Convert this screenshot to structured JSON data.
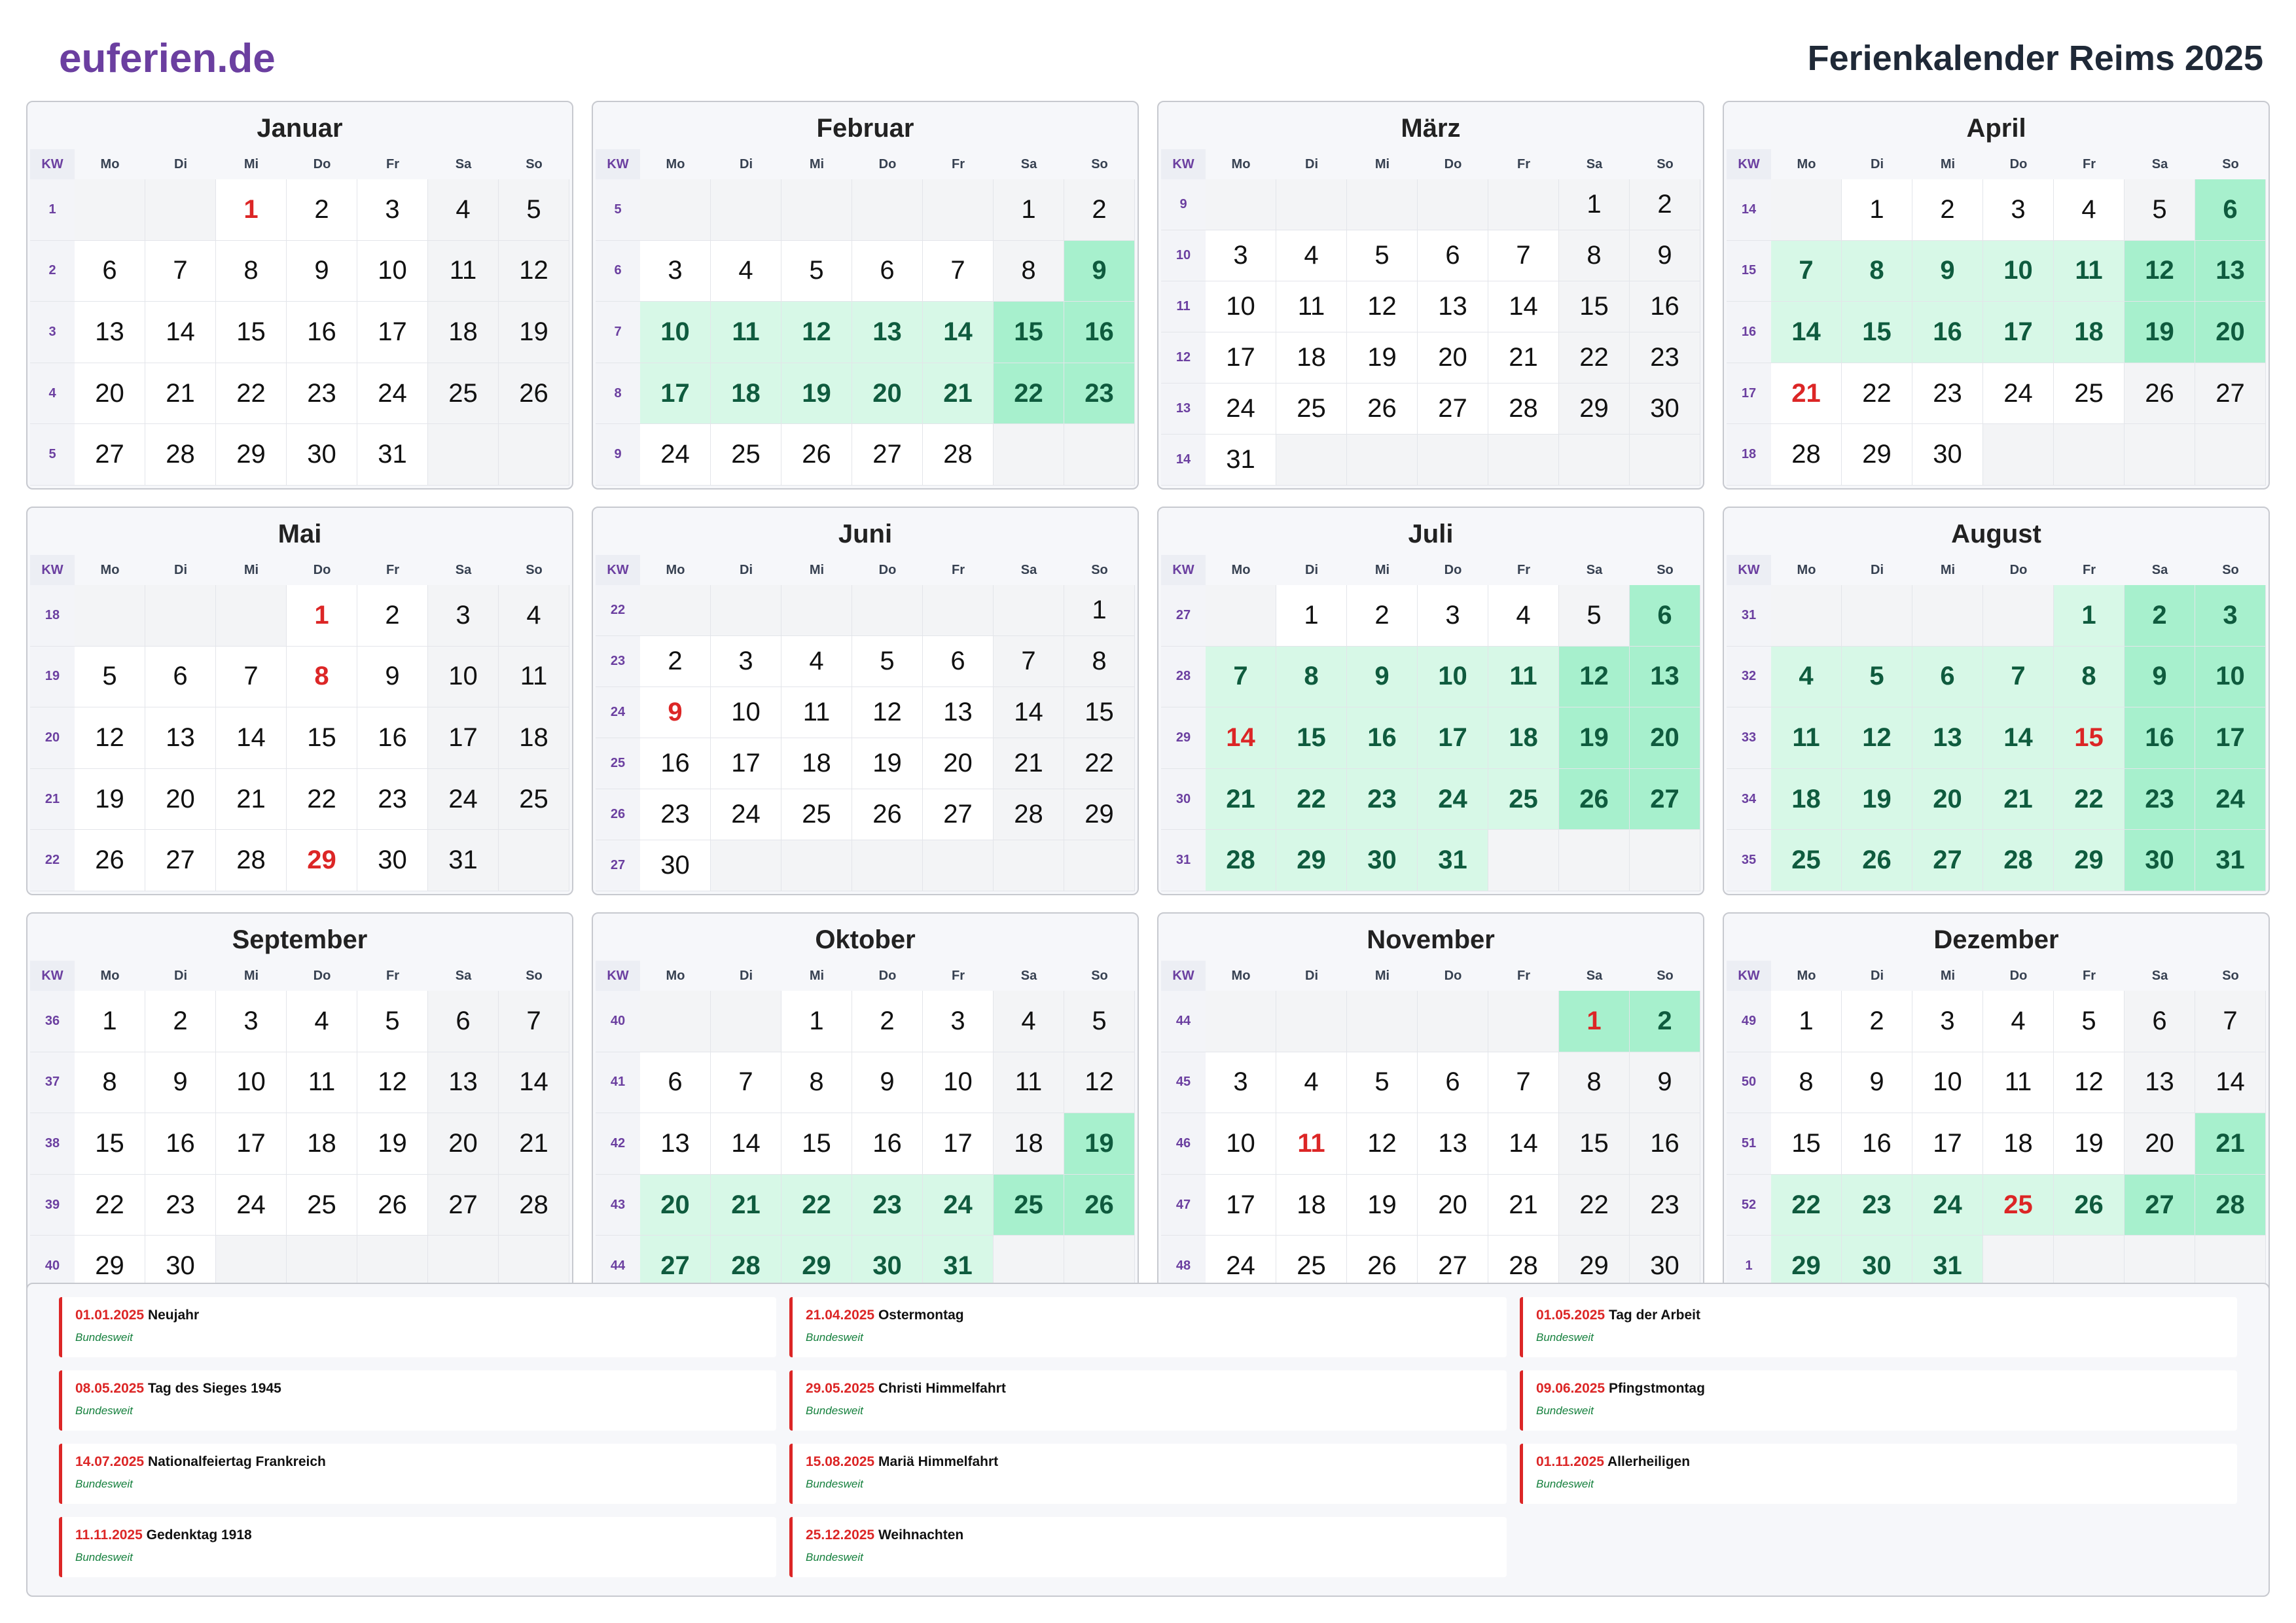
{
  "header": {
    "brand": "euferien.de",
    "title": "Ferienkalender Reims 2025"
  },
  "weekday_headers": [
    "KW",
    "Mo",
    "Di",
    "Mi",
    "Do",
    "Fr",
    "Sa",
    "So"
  ],
  "colors": {
    "brand": "#6b3fa0",
    "holiday": "#dc2626",
    "vacation": "#d7f8e7",
    "vacation_weekend": "#a7f0cd",
    "weekend": "#f3f4f6",
    "scope": "#15803d"
  },
  "months": [
    {
      "name": "Januar",
      "offset": 2,
      "days": 31,
      "weeks": [
        "1",
        "2",
        "3",
        "4",
        "5"
      ],
      "holidays": [
        1
      ],
      "vacation": []
    },
    {
      "name": "Februar",
      "offset": 5,
      "days": 28,
      "weeks": [
        "5",
        "6",
        "7",
        "8",
        "9"
      ],
      "holidays": [],
      "vacation": [
        9,
        10,
        11,
        12,
        13,
        14,
        15,
        16,
        17,
        18,
        19,
        20,
        21,
        22,
        23
      ]
    },
    {
      "name": "März",
      "offset": 5,
      "days": 31,
      "weeks": [
        "9",
        "10",
        "11",
        "12",
        "13",
        "14"
      ],
      "holidays": [],
      "vacation": []
    },
    {
      "name": "April",
      "offset": 1,
      "days": 30,
      "weeks": [
        "14",
        "15",
        "16",
        "17",
        "18"
      ],
      "holidays": [
        21
      ],
      "vacation": [
        6,
        7,
        8,
        9,
        10,
        11,
        12,
        13,
        14,
        15,
        16,
        17,
        18,
        19,
        20
      ]
    },
    {
      "name": "Mai",
      "offset": 3,
      "days": 31,
      "weeks": [
        "18",
        "19",
        "20",
        "21",
        "22"
      ],
      "holidays": [
        1,
        8,
        29
      ],
      "vacation": []
    },
    {
      "name": "Juni",
      "offset": 6,
      "days": 30,
      "weeks": [
        "22",
        "23",
        "24",
        "25",
        "26",
        "27"
      ],
      "holidays": [
        9
      ],
      "vacation": []
    },
    {
      "name": "Juli",
      "offset": 1,
      "days": 31,
      "weeks": [
        "27",
        "28",
        "29",
        "30",
        "31"
      ],
      "holidays": [
        14
      ],
      "vacation": [
        6,
        7,
        8,
        9,
        10,
        11,
        12,
        13,
        14,
        15,
        16,
        17,
        18,
        19,
        20,
        21,
        22,
        23,
        24,
        25,
        26,
        27,
        28,
        29,
        30,
        31
      ]
    },
    {
      "name": "August",
      "offset": 4,
      "days": 31,
      "weeks": [
        "31",
        "32",
        "33",
        "34",
        "35"
      ],
      "holidays": [
        15
      ],
      "vacation": [
        1,
        2,
        3,
        4,
        5,
        6,
        7,
        8,
        9,
        10,
        11,
        12,
        13,
        14,
        15,
        16,
        17,
        18,
        19,
        20,
        21,
        22,
        23,
        24,
        25,
        26,
        27,
        28,
        29,
        30,
        31
      ]
    },
    {
      "name": "September",
      "offset": 0,
      "days": 30,
      "weeks": [
        "36",
        "37",
        "38",
        "39",
        "40"
      ],
      "holidays": [],
      "vacation": []
    },
    {
      "name": "Oktober",
      "offset": 2,
      "days": 31,
      "weeks": [
        "40",
        "41",
        "42",
        "43",
        "44"
      ],
      "holidays": [],
      "vacation": [
        19,
        20,
        21,
        22,
        23,
        24,
        25,
        26,
        27,
        28,
        29,
        30,
        31
      ]
    },
    {
      "name": "November",
      "offset": 5,
      "days": 30,
      "weeks": [
        "44",
        "45",
        "46",
        "47",
        "48"
      ],
      "holidays": [
        1,
        11
      ],
      "vacation": [
        1,
        2
      ]
    },
    {
      "name": "Dezember",
      "offset": 0,
      "days": 31,
      "weeks": [
        "49",
        "50",
        "51",
        "52",
        "1"
      ],
      "holidays": [
        25
      ],
      "vacation": [
        21,
        22,
        23,
        24,
        25,
        26,
        27,
        28,
        29,
        30,
        31
      ]
    }
  ],
  "holidays_list": [
    {
      "date": "01.01.2025",
      "name": "Neujahr",
      "scope": "Bundesweit"
    },
    {
      "date": "21.04.2025",
      "name": "Ostermontag",
      "scope": "Bundesweit"
    },
    {
      "date": "01.05.2025",
      "name": "Tag der Arbeit",
      "scope": "Bundesweit"
    },
    {
      "date": "08.05.2025",
      "name": "Tag des Sieges 1945",
      "scope": "Bundesweit"
    },
    {
      "date": "29.05.2025",
      "name": "Christi Himmelfahrt",
      "scope": "Bundesweit"
    },
    {
      "date": "09.06.2025",
      "name": "Pfingstmontag",
      "scope": "Bundesweit"
    },
    {
      "date": "14.07.2025",
      "name": "Nationalfeiertag Frankreich",
      "scope": "Bundesweit"
    },
    {
      "date": "15.08.2025",
      "name": "Mariä Himmelfahrt",
      "scope": "Bundesweit"
    },
    {
      "date": "01.11.2025",
      "name": "Allerheiligen",
      "scope": "Bundesweit"
    },
    {
      "date": "11.11.2025",
      "name": "Gedenktag 1918",
      "scope": "Bundesweit"
    },
    {
      "date": "25.12.2025",
      "name": "Weihnachten",
      "scope": "Bundesweit"
    }
  ]
}
